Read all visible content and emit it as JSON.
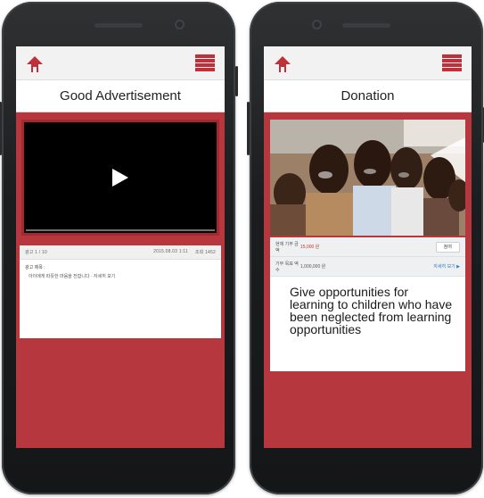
{
  "left_screen": {
    "title": "Good Advertisement",
    "ad_meta": {
      "left": "광고 1 / 10",
      "date": "2015.08.03 1:11",
      "views": "조회 1452"
    },
    "ad_label": "광고 제목 :",
    "ad_text": "아이에게 따뜻한 마음을 전합니다 · 자세히 보기"
  },
  "right_screen": {
    "title": "Donation",
    "rows": [
      {
        "label": "현재 기부 금액",
        "value": "15,000 원",
        "action": "참여"
      },
      {
        "label": "기부 목표 액수",
        "value": "1,000,000 원",
        "action": "자세히 보기 ▶"
      }
    ],
    "description": "Give opportunities for learning to children who have been neglected from learning opportunities"
  },
  "colors": {
    "brand_red": "#b6373d",
    "header_gray": "#f2f2f2"
  },
  "icons": [
    "home-icon",
    "menu-icon",
    "play-icon"
  ]
}
